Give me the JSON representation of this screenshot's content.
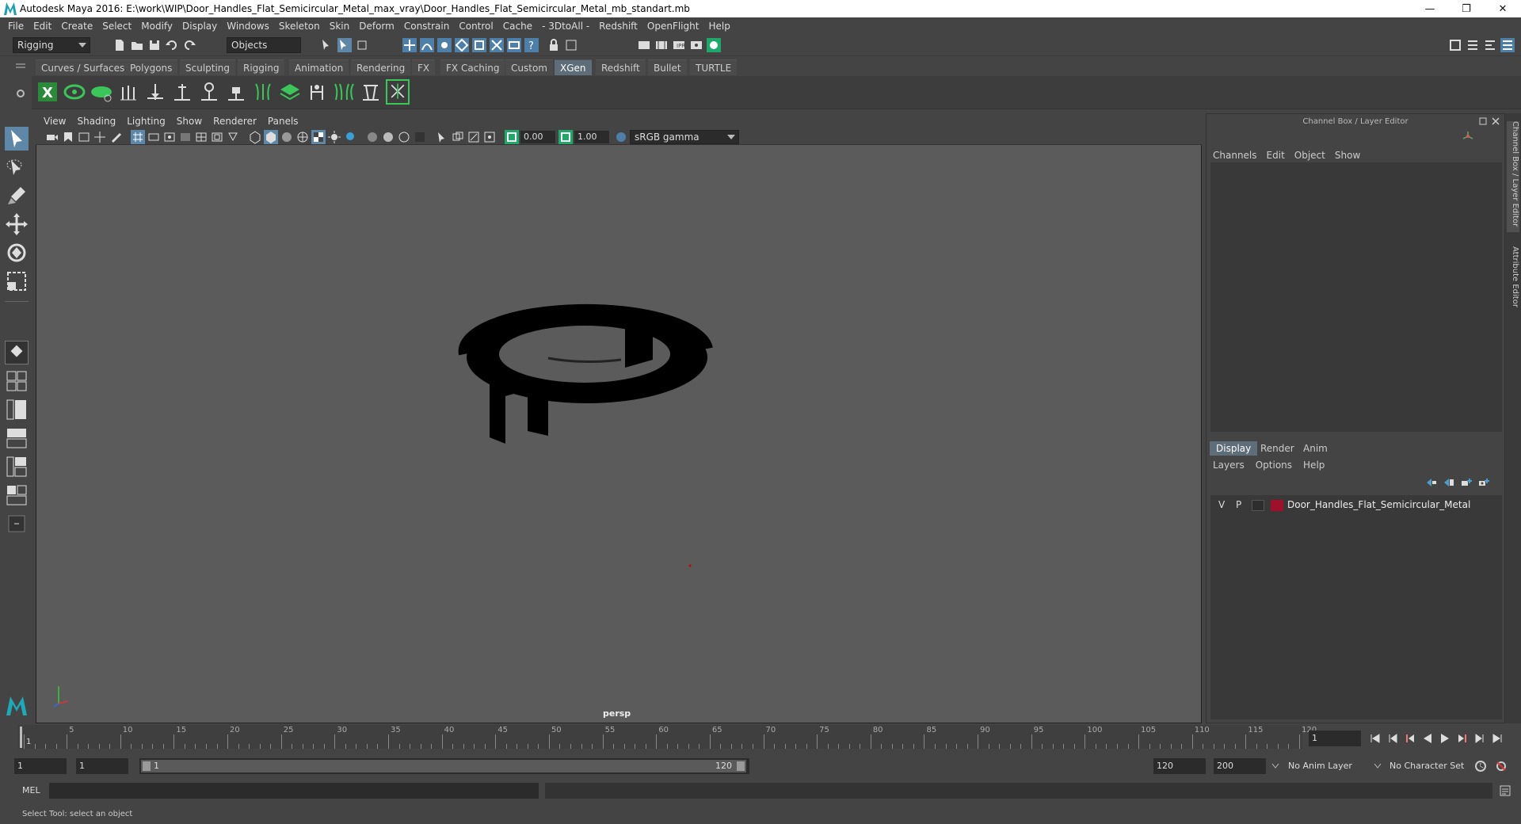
{
  "window": {
    "title": "Autodesk Maya 2016: E:\\work\\WIP\\Door_Handles_Flat_Semicircular_Metal_max_vray\\Door_Handles_Flat_Semicircular_Metal_mb_standart.mb",
    "minimize": "—",
    "maximize": "❐",
    "close": "✕"
  },
  "menu": [
    "File",
    "Edit",
    "Create",
    "Select",
    "Modify",
    "Display",
    "Windows",
    "Skeleton",
    "Skin",
    "Deform",
    "Constrain",
    "Control",
    "Cache",
    "- 3DtoAll -",
    "Redshift",
    "OpenFlight",
    "Help"
  ],
  "statusline": {
    "menuset": "Rigging",
    "selection_mode": "Objects"
  },
  "shelf": {
    "tabs": [
      "Curves / Surfaces",
      "Polygons",
      "Sculpting",
      "Rigging",
      "Animation",
      "Rendering",
      "FX",
      "FX Caching",
      "Custom",
      "XGen",
      "Redshift",
      "Bullet",
      "TURTLE"
    ],
    "active_tab": "XGen"
  },
  "viewport": {
    "menu": [
      "View",
      "Shading",
      "Lighting",
      "Show",
      "Renderer",
      "Panels"
    ],
    "exposure": "0.00",
    "gamma": "1.00",
    "color_space": "sRGB gamma",
    "camera": "persp"
  },
  "channel_box": {
    "header": "Channel Box / Layer Editor",
    "menu": [
      "Channels",
      "Edit",
      "Object",
      "Show"
    ]
  },
  "layer_editor": {
    "tabs": [
      "Display",
      "Render",
      "Anim"
    ],
    "active_tab": "Display",
    "menu": [
      "Layers",
      "Options",
      "Help"
    ],
    "layers": [
      {
        "v": "V",
        "p": "P",
        "name": "Door_Handles_Flat_Semicircular_Metal",
        "color": "#a0102a"
      }
    ]
  },
  "side_tabs": [
    "Channel Box / Layer Editor",
    "Attribute Editor"
  ],
  "timeline": {
    "ticks": [
      "1",
      "5",
      "10",
      "15",
      "20",
      "25",
      "30",
      "35",
      "40",
      "45",
      "50",
      "55",
      "60",
      "65",
      "70",
      "75",
      "80",
      "85",
      "90",
      "95",
      "100",
      "105",
      "110",
      "115",
      "120"
    ],
    "current_frame": "1"
  },
  "range": {
    "start": "1",
    "anim_start": "1",
    "slider_start": "1",
    "slider_end": "120",
    "end": "120",
    "anim_end": "200",
    "anim_layer": "No Anim Layer",
    "char_set": "No Character Set"
  },
  "command": {
    "label": "MEL"
  },
  "help_line": "Select Tool: select an object",
  "colors": {
    "accent": "#5e6d7a",
    "viewport_bg": "#5b5b5b",
    "panel_bg": "#444444"
  }
}
